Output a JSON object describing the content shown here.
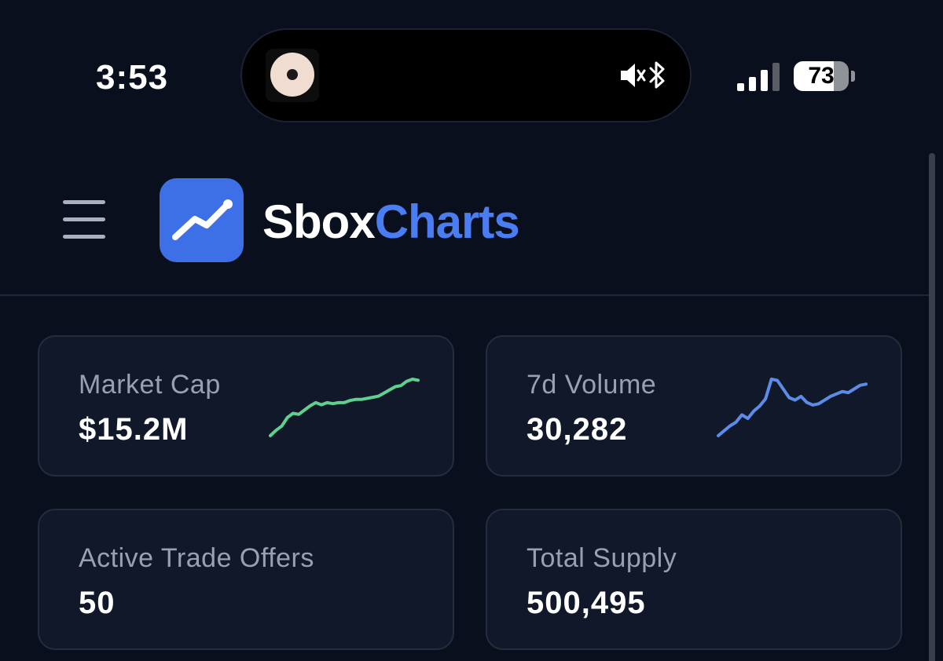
{
  "status_bar": {
    "time": "3:53",
    "battery_level": "73",
    "battery_fraction": 0.73,
    "signal_bars_active": 3,
    "signal_bars_total": 4,
    "island_icons": [
      "mute-icon",
      "bluetooth-icon"
    ]
  },
  "header": {
    "brand_part1": "Sbox",
    "brand_part2": "Charts",
    "menu_icon": "hamburger-menu-icon",
    "logo_icon": "trend-up-icon"
  },
  "colors": {
    "background": "#0a0f1e",
    "card_background": "#111829",
    "accent_blue": "#4b7df2",
    "logo_tile": "#3d6fe6",
    "spark_green": "#5fd08e",
    "spark_blue": "#5b8de8"
  },
  "cards": [
    {
      "label": "Market Cap",
      "value": "$15.2M",
      "sparkline": {
        "color": "#5fd08e",
        "values": [
          2,
          7,
          11,
          19,
          23,
          22,
          26,
          30,
          33,
          31,
          33,
          32,
          33,
          33,
          35,
          36,
          36,
          37,
          38,
          39,
          42,
          45,
          48,
          49,
          53,
          55,
          54
        ]
      }
    },
    {
      "label": "7d Volume",
      "value": "30,282",
      "sparkline": {
        "color": "#5b8de8",
        "values": [
          4,
          8,
          12,
          15,
          21,
          18,
          24,
          28,
          34,
          50,
          49,
          42,
          35,
          33,
          36,
          31,
          29,
          30,
          33,
          36,
          38,
          40,
          39,
          42,
          45,
          46
        ]
      }
    },
    {
      "label": "Active Trade Offers",
      "value": "50"
    },
    {
      "label": "Total Supply",
      "value": "500,495"
    }
  ]
}
